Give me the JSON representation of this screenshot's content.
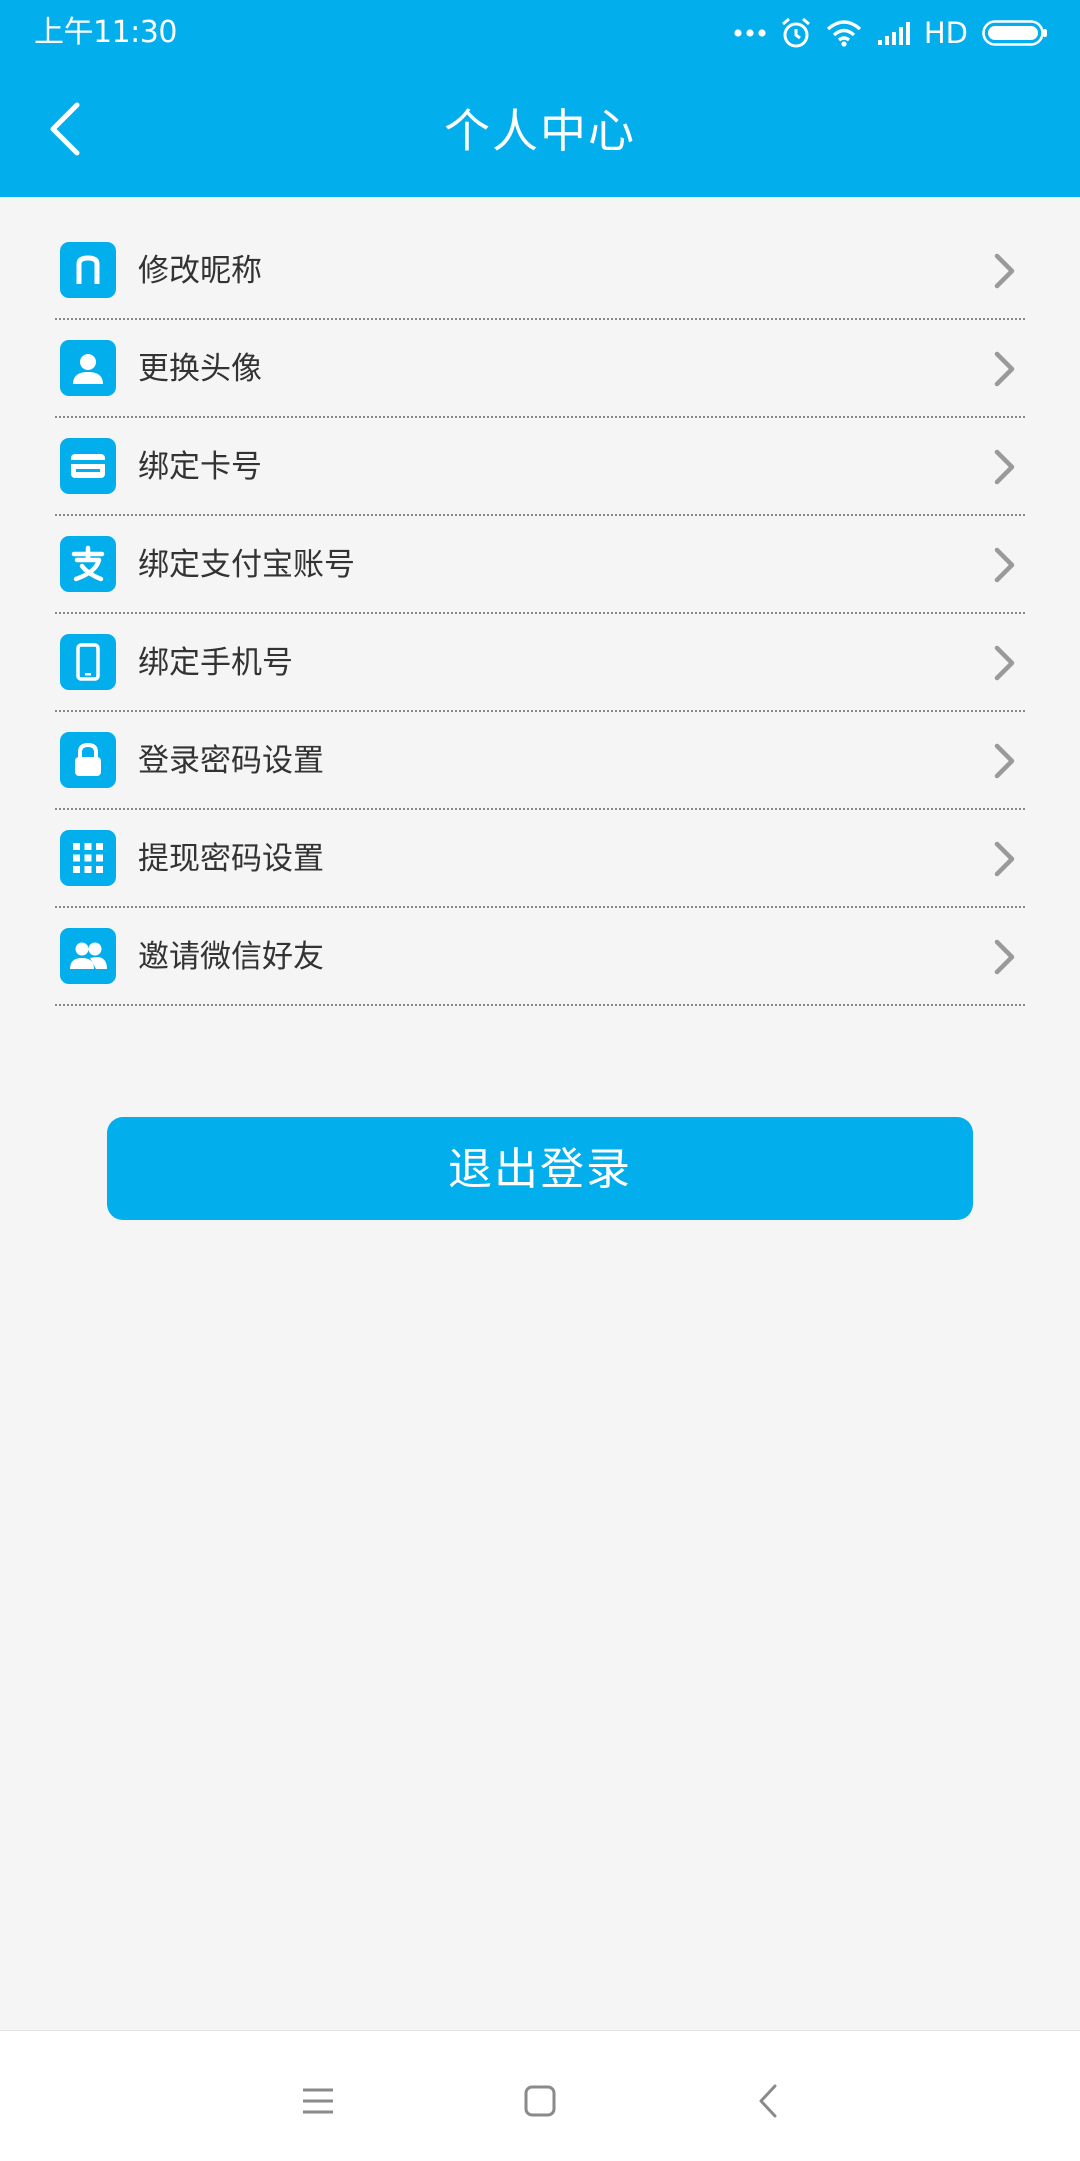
{
  "status_bar": {
    "time": "上午11:30",
    "network_label": "HD",
    "icons": [
      "more-dots-icon",
      "alarm-icon",
      "wifi-icon",
      "signal-icon",
      "battery-icon"
    ]
  },
  "header": {
    "title": "个人中心",
    "back_icon": "chevron-left-icon"
  },
  "menu": {
    "items": [
      {
        "label": "修改昵称",
        "icon": "nickname-icon"
      },
      {
        "label": "更换头像",
        "icon": "avatar-icon"
      },
      {
        "label": "绑定卡号",
        "icon": "card-icon"
      },
      {
        "label": "绑定支付宝账号",
        "icon": "alipay-icon"
      },
      {
        "label": "绑定手机号",
        "icon": "phone-icon"
      },
      {
        "label": "登录密码设置",
        "icon": "lock-icon"
      },
      {
        "label": "提现密码设置",
        "icon": "keypad-icon"
      },
      {
        "label": "邀请微信好友",
        "icon": "friends-icon"
      }
    ]
  },
  "logout_button": {
    "label": "退出登录"
  },
  "nav_bar": {
    "icons": [
      "menu-icon",
      "home-icon",
      "back-icon"
    ]
  },
  "colors": {
    "accent": "#02aeeb",
    "background": "#f5f5f5",
    "text": "#333333",
    "chevron": "#9a9a9a"
  }
}
